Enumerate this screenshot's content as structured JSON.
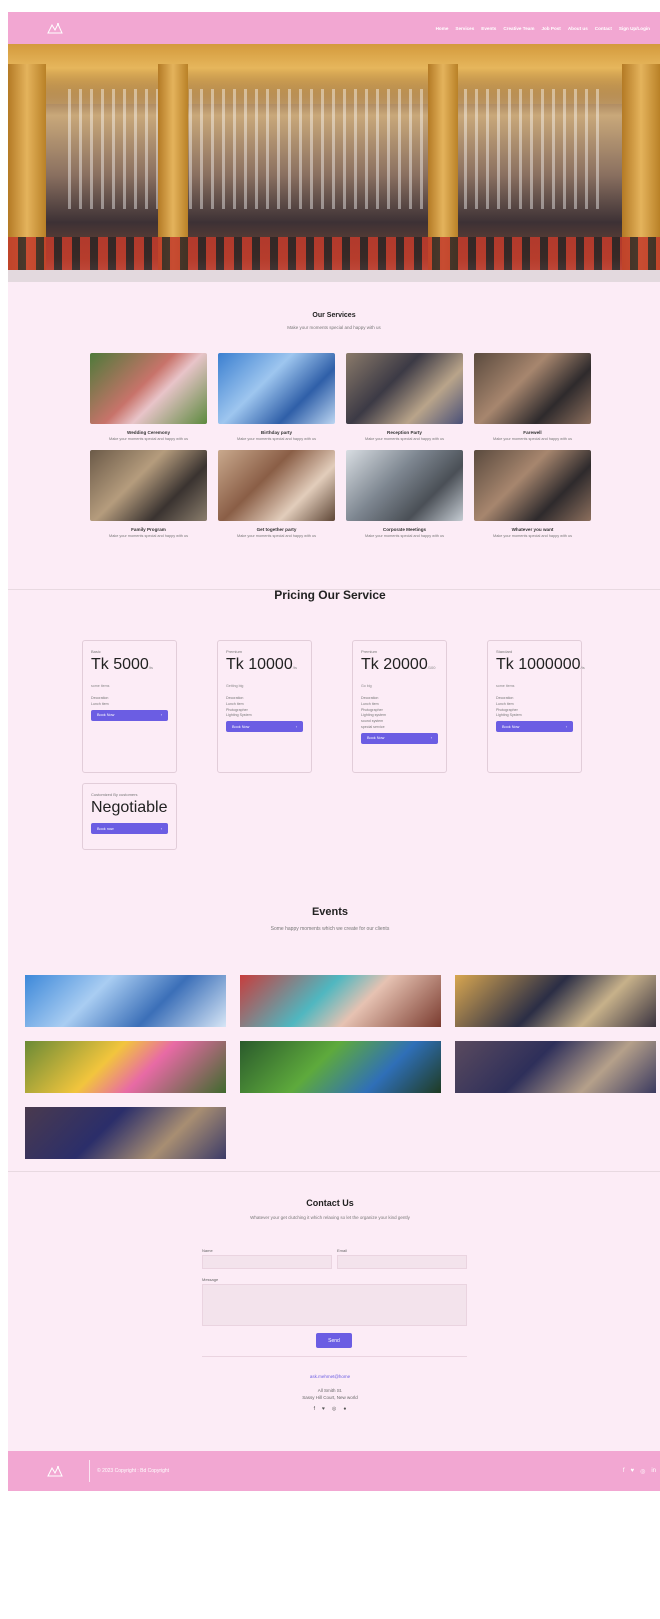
{
  "nav": {
    "links": [
      "Home",
      "Services",
      "Events",
      "Creative Team",
      "Job Post",
      "About us",
      "Contact",
      "Sign Up/Login"
    ]
  },
  "services": {
    "title": "Our Services",
    "subtitle": "Make your moments special and happy with us",
    "items": [
      {
        "title": "Wedding Ceremony",
        "desc": "Make your moments special and happy with us"
      },
      {
        "title": "Birthday party",
        "desc": "Make your moments special and happy with us"
      },
      {
        "title": "Reception Party",
        "desc": "Make your moments special and happy with us"
      },
      {
        "title": "Farewell",
        "desc": "Make your moments special and happy with us"
      },
      {
        "title": "Family Program",
        "desc": "Make your moments special and happy with us"
      },
      {
        "title": "Get together party",
        "desc": "Make your moments special and happy with us"
      },
      {
        "title": "Corporate Meetings",
        "desc": "Make your moments special and happy with us"
      },
      {
        "title": "Whatever you want",
        "desc": "Make your moments special and happy with us"
      }
    ]
  },
  "pricing": {
    "title": "Pricing Our Service",
    "plans": [
      {
        "name": "Basic",
        "price": "Tk 5000",
        "per": "/ts",
        "note": "some items",
        "features": [
          "Decoration",
          "Lunch item"
        ],
        "button": "Book Now"
      },
      {
        "name": "Premium",
        "price": "Tk 10000",
        "per": "/ts",
        "note": "Getting big",
        "features": [
          "Decoration",
          "Lunch item",
          "Photographer",
          "Lighting System"
        ],
        "button": "Book Now"
      },
      {
        "name": "Premium",
        "price": "Tk 20000",
        "per": "/100",
        "note": "Go big",
        "features": [
          "Decoration",
          "Lunch item",
          "Photographer",
          "Lighting system",
          "sound system",
          "special service"
        ],
        "button": "Book Now"
      },
      {
        "name": "Standard",
        "price": "Tk 1000000",
        "per": "/ts",
        "note": "some items",
        "features": [
          "Decoration",
          "Lunch item",
          "Photographer",
          "Lighting System"
        ],
        "button": "Book Now"
      },
      {
        "name": "Customized By customers",
        "price": "Negotiable",
        "per": "",
        "note": "",
        "features": [],
        "button": "Book now"
      }
    ]
  },
  "events": {
    "title": "Events",
    "subtitle": "Some happy moments which we create for our clients"
  },
  "contact": {
    "title": "Contact Us",
    "subtitle": "Whatever your get clutching it which relaxing so let the organize your kind gently",
    "name_label": "Name",
    "email_label": "Email",
    "message_label": "Message",
    "send": "Send",
    "email": "ask.mehmet@home",
    "address_1": "All Smith St.",
    "address_2": "Sassy Hill Court, New world"
  },
  "footer": {
    "copyright": "© 2023 Copyright : Bd Copyright"
  },
  "colors": {
    "nav": "#f2a7d2",
    "background": "#fcecf6",
    "accent": "#6b5de3"
  }
}
